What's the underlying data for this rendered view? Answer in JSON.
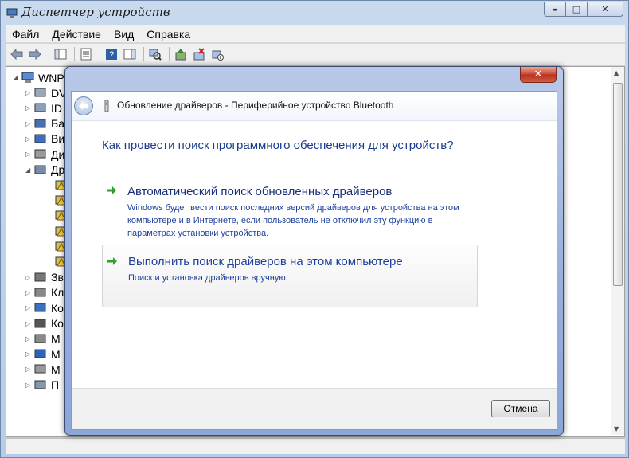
{
  "window": {
    "title": "Диспетчер устройств",
    "controls": {
      "minimize": "▬",
      "maximize": "□",
      "close": "✕"
    }
  },
  "menu": [
    "Файл",
    "Действие",
    "Вид",
    "Справка"
  ],
  "tree": {
    "root": "WNP",
    "items": [
      {
        "label": "DV",
        "arrow": "▷",
        "icon": "dvd-drive-icon"
      },
      {
        "label": "ID",
        "arrow": "▷",
        "icon": "ide-controller-icon"
      },
      {
        "label": "Ба",
        "arrow": "▷",
        "icon": "bluetooth-radio-icon"
      },
      {
        "label": "Ви",
        "arrow": "▷",
        "icon": "display-adapter-icon"
      },
      {
        "label": "Ди",
        "arrow": "▷",
        "icon": "disk-drive-icon"
      },
      {
        "label": "Др",
        "arrow": "◢",
        "icon": "other-devices-icon"
      },
      {
        "label": "",
        "arrow": "",
        "icon": "unknown-device-icon"
      },
      {
        "label": "",
        "arrow": "",
        "icon": "unknown-device-icon"
      },
      {
        "label": "",
        "arrow": "",
        "icon": "unknown-device-icon"
      },
      {
        "label": "",
        "arrow": "",
        "icon": "unknown-device-icon"
      },
      {
        "label": "",
        "arrow": "",
        "icon": "unknown-device-icon"
      },
      {
        "label": "",
        "arrow": "",
        "icon": "unknown-device-icon"
      },
      {
        "label": "Зв",
        "arrow": "▷",
        "icon": "sound-icon"
      },
      {
        "label": "Кл",
        "arrow": "▷",
        "icon": "keyboard-icon"
      },
      {
        "label": "Ко",
        "arrow": "▷",
        "icon": "computer-icon"
      },
      {
        "label": "Ко",
        "arrow": "▷",
        "icon": "usb-controller-icon"
      },
      {
        "label": "М",
        "arrow": "▷",
        "icon": "memory-device-icon"
      },
      {
        "label": "М",
        "arrow": "▷",
        "icon": "monitor-icon"
      },
      {
        "label": "М",
        "arrow": "▷",
        "icon": "mouse-icon"
      },
      {
        "label": "П",
        "arrow": "▷",
        "icon": "ports-icon"
      }
    ]
  },
  "dialog": {
    "close": "✕",
    "title": "Обновление драйверов - Периферийное устройство Bluetooth",
    "question": "Как провести поиск программного обеспечения для устройств?",
    "options": [
      {
        "title": "Автоматический поиск обновленных драйверов",
        "description": "Windows будет вести поиск последних версий драйверов для устройства на этом компьютере и в Интернете, если пользователь не отключил эту функцию в параметрах установки устройства."
      },
      {
        "title": "Выполнить поиск драйверов на этом компьютере",
        "description": "Поиск и установка драйверов вручную."
      }
    ],
    "cancel": "Отмена"
  },
  "colors": {
    "question": "#1a3c8c",
    "link": "#1e3f9c",
    "arrow_green": "#2ea12e",
    "dialog_frame": "#97aede"
  }
}
